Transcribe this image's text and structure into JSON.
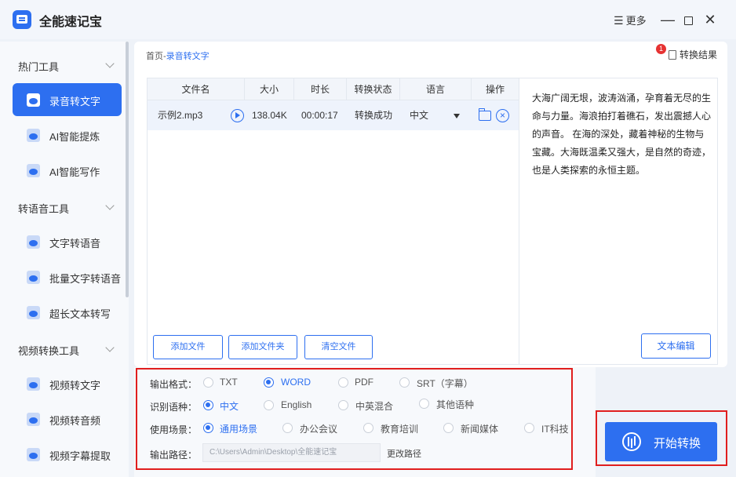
{
  "app": {
    "title": "全能速记宝"
  },
  "titlebar": {
    "more_label": "更多",
    "min_glyph": "—",
    "close_glyph": "✕",
    "more_glyph": "☰"
  },
  "sidebar": {
    "groups": [
      {
        "label": "热门工具",
        "items": [
          "录音转文字",
          "AI智能提炼",
          "AI智能写作"
        ]
      },
      {
        "label": "转语音工具",
        "items": [
          "文字转语音",
          "批量文字转语音",
          "超长文本转写"
        ]
      },
      {
        "label": "视频转换工具",
        "items": [
          "视频转文字",
          "视频转音频",
          "视频字幕提取"
        ]
      }
    ],
    "active_item": "录音转文字"
  },
  "breadcrumb": {
    "home": "首页",
    "separator": "-",
    "current": "录音转文字"
  },
  "result": {
    "label": "转换结果",
    "badge": "1"
  },
  "table": {
    "headers": [
      "文件名",
      "大小",
      "时长",
      "转换状态",
      "语言",
      "操作"
    ],
    "rows": [
      {
        "name": "示例2.mp3",
        "size": "138.04K",
        "duration": "00:00:17",
        "status": "转换成功",
        "language": "中文"
      }
    ]
  },
  "file_buttons": {
    "add_file": "添加文件",
    "add_folder": "添加文件夹",
    "clear": "清空文件"
  },
  "preview": {
    "text": "大海广阔无垠，波涛汹涌，孕育着无尽的生命与力量。海浪拍打着礁石，发出震撼人心的声音。 在海的深处，藏着神秘的生物与宝藏。大海既温柔又强大，是自然的奇迹，也是人类探索的永恒主题。",
    "edit_button": "文本编辑"
  },
  "options": {
    "format": {
      "label": "输出格式：",
      "choices": [
        "TXT",
        "WORD",
        "PDF",
        "SRT（字幕）"
      ],
      "selected": "WORD"
    },
    "language": {
      "label": "识别语种：",
      "choices": [
        "中文",
        "English",
        "中英混合",
        "其他语种"
      ],
      "selected": "中文"
    },
    "scene": {
      "label": "使用场景：",
      "choices": [
        "通用场景",
        "办公会议",
        "教育培训",
        "新闻媒体",
        "IT科技"
      ],
      "selected": "通用场景"
    },
    "path": {
      "label": "输出路径：",
      "value": "C:\\Users\\Admin\\Desktop\\全能速记宝",
      "change": "更改路径"
    }
  },
  "start": {
    "label": "开始转换"
  },
  "colors": {
    "accent": "#2d6ff0",
    "highlight_frame": "#e01e1e"
  }
}
